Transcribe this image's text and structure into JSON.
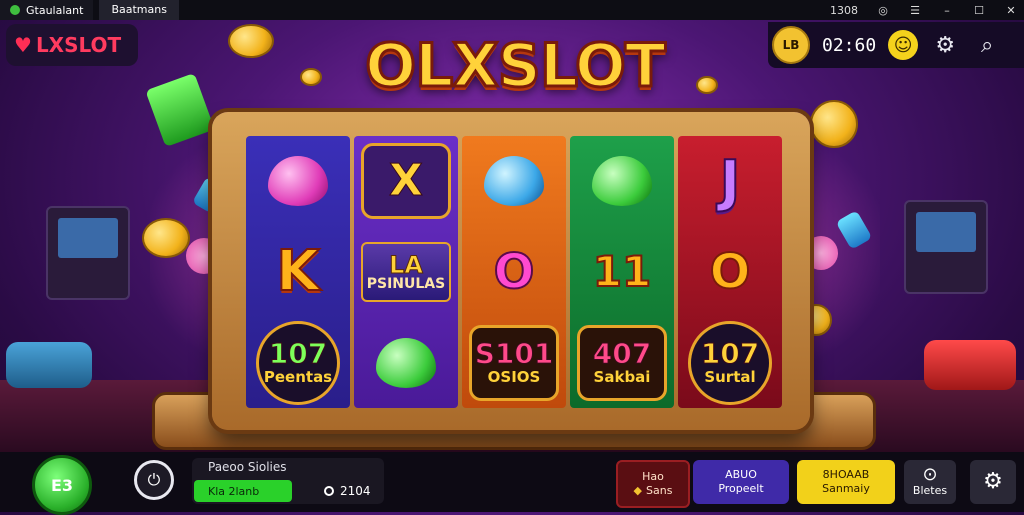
{
  "topbar": {
    "app_name": "Gtaulalant",
    "tab_label": "Baatmans",
    "right_text": "1308"
  },
  "header": {
    "logo_text": "LXSLOT",
    "coin_button_label": "LB",
    "timer": "02:60"
  },
  "game": {
    "title": "OLXSLOT",
    "reels": [
      [
        {
          "kind": "gem",
          "color": "pink"
        },
        {
          "kind": "letter",
          "text": "K"
        },
        {
          "kind": "badge",
          "big": "107",
          "small": "Peentas"
        }
      ],
      [
        {
          "kind": "framed-letter",
          "text": "X"
        },
        {
          "kind": "plate",
          "big": "LA",
          "small": "PSINULAS"
        },
        {
          "kind": "gem",
          "color": "green"
        }
      ],
      [
        {
          "kind": "gem",
          "color": "blue"
        },
        {
          "kind": "o",
          "text": "O"
        },
        {
          "kind": "badge",
          "big": "S101",
          "small": "OSIOS"
        }
      ],
      [
        {
          "kind": "gem",
          "color": "green"
        },
        {
          "kind": "number",
          "text": "11"
        },
        {
          "kind": "badge",
          "big": "407",
          "small": "Sakbai"
        }
      ],
      [
        {
          "kind": "letter",
          "text": "J"
        },
        {
          "kind": "o",
          "text": "O"
        },
        {
          "kind": "badge",
          "big": "107",
          "small": "Surtal"
        }
      ]
    ]
  },
  "bottom": {
    "play_button_label": "E3",
    "stats": {
      "label": "Paeoo Siolies",
      "bar_text": "Kla 2lanb",
      "value": "2104"
    },
    "btn_red": {
      "line1": "Hao",
      "line2": "Sans"
    },
    "btn_purple": {
      "line1": "ABUO",
      "line2": "Propeelt"
    },
    "btn_yellow": {
      "line1": "8HOAAB",
      "line2": "Sanmaiy"
    },
    "btn_dark": {
      "label": "Bletes"
    }
  },
  "colors": {
    "accent": "#ffd23a",
    "play_green": "#2ab02a",
    "purple_button": "#3f2aa8",
    "yellow_button": "#f2d11a"
  }
}
